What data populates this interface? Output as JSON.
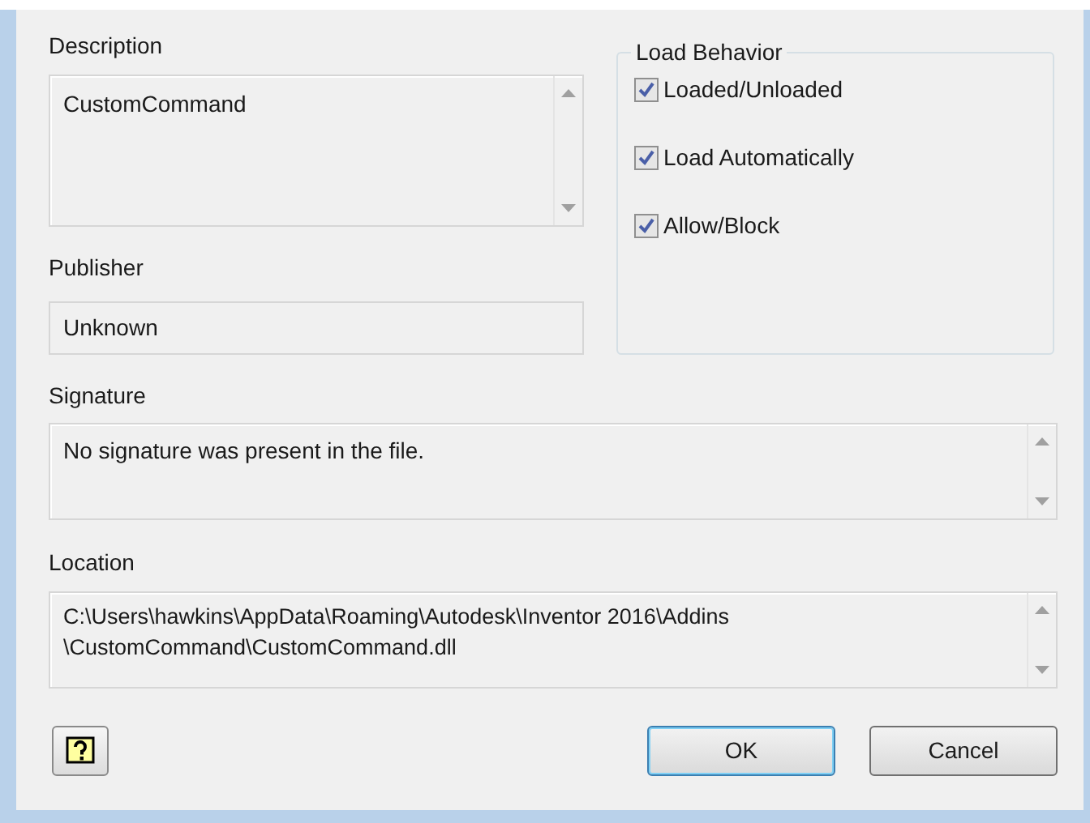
{
  "description": {
    "label": "Description",
    "value": "CustomCommand"
  },
  "publisher": {
    "label": "Publisher",
    "value": "Unknown"
  },
  "load_behavior": {
    "title": "Load Behavior",
    "options": [
      {
        "label": "Loaded/Unloaded",
        "checked": true
      },
      {
        "label": "Load Automatically",
        "checked": true
      },
      {
        "label": "Allow/Block",
        "checked": true
      }
    ]
  },
  "signature": {
    "label": "Signature",
    "value": "No signature was present in the file."
  },
  "location": {
    "label": "Location",
    "lines": [
      "C:\\Users\\hawkins\\AppData\\Roaming\\Autodesk\\Inventor 2016\\Addins",
      "\\CustomCommand\\CustomCommand.dll"
    ]
  },
  "buttons": [
    {
      "label": "OK",
      "default": true
    },
    {
      "label": "Cancel",
      "default": false
    }
  ]
}
